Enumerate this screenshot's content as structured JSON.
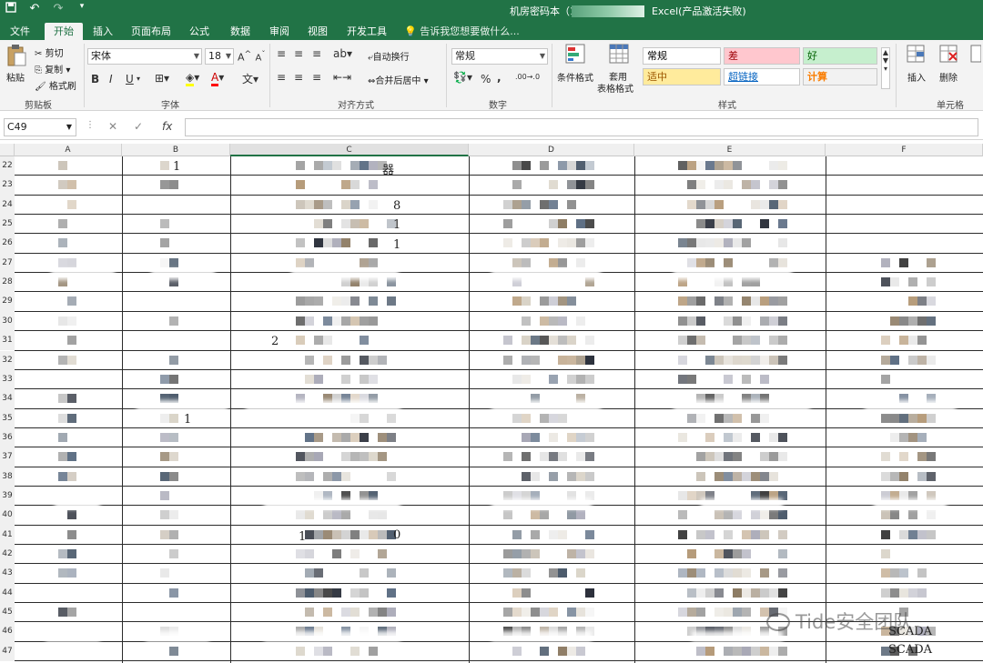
{
  "title_bar": {
    "qat": {
      "save_icon": "save-icon",
      "undo_icon": "undo-icon",
      "redo_icon": "redo-icon",
      "customize_icon": "customize-qat-icon"
    },
    "document_title": "机房密码本（1",
    "app_status": "Excel(产品激活失败)"
  },
  "tabs": [
    "文件",
    "开始",
    "插入",
    "页面布局",
    "公式",
    "数据",
    "审阅",
    "视图",
    "开发工具"
  ],
  "tell_me": "告诉我您想要做什么...",
  "ribbon": {
    "clipboard": {
      "paste": "粘贴",
      "cut": "剪切",
      "copy": "复制",
      "format_painter": "格式刷",
      "label": "剪贴板"
    },
    "font": {
      "name": "宋体",
      "size": "18",
      "bold": "B",
      "italic": "I",
      "underline": "U",
      "label": "字体"
    },
    "alignment": {
      "wrap": "自动换行",
      "merge": "合并后居中",
      "label": "对齐方式"
    },
    "number": {
      "format": "常规",
      "percent": "%",
      "comma": ",",
      "label": "数字"
    },
    "styles": {
      "conditional": "条件格式",
      "table_format_1": "套用",
      "table_format_2": "表格格式",
      "cells": [
        {
          "text": "常规",
          "bg": "#ffffff",
          "fg": "#000000"
        },
        {
          "text": "差",
          "bg": "#ffc7ce",
          "fg": "#9c0006"
        },
        {
          "text": "好",
          "bg": "#c6efce",
          "fg": "#006100"
        },
        {
          "text": "适中",
          "bg": "#ffeb9c",
          "fg": "#9c5700"
        },
        {
          "text": "超链接",
          "bg": "#ffffff",
          "fg": "#0563c1"
        },
        {
          "text": "计算",
          "bg": "#f2f2f2",
          "fg": "#fa7d00"
        }
      ],
      "label": "样式"
    },
    "cells_group": {
      "insert": "插入",
      "delete": "删除",
      "label": "单元格"
    }
  },
  "formula_bar": {
    "name_box": "C49",
    "cancel": "✕",
    "enter": "✓",
    "fx": "fx"
  },
  "columns": [
    "A",
    "B",
    "C",
    "D",
    "E",
    "F"
  ],
  "rows": [
    "22",
    "23",
    "24",
    "25",
    "26",
    "27",
    "28",
    "29",
    "30",
    "31",
    "32",
    "33",
    "34",
    "35",
    "36",
    "37",
    "38",
    "39",
    "40",
    "41",
    "42",
    "43",
    "44",
    "45",
    "46",
    "47"
  ],
  "visible_cells": {
    "b22": "1",
    "c22": "器",
    "c24": "8",
    "c25": "1",
    "c26": "1",
    "c31": "2",
    "b35": "1",
    "c41": "1",
    "c41b": "0",
    "f46": "SCADA",
    "f47": "SCADA"
  },
  "watermark": "Tide安全团队",
  "colors": {
    "excel_green": "#217346"
  }
}
